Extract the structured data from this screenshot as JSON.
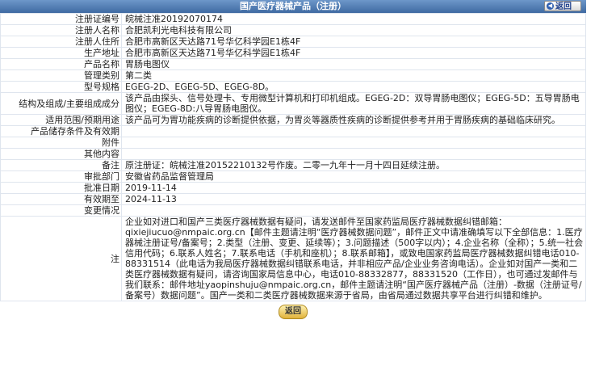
{
  "header": {
    "title": "国产医疗器械产品（注册）",
    "back_label": "返回"
  },
  "rows": [
    {
      "label": "注册证编号",
      "value": "皖械注准20192070174"
    },
    {
      "label": "注册人名称",
      "value": "合肥凯利光电科技有限公司"
    },
    {
      "label": "注册人住所",
      "value": "合肥市高新区天达路71号华亿科学园E1栋4F"
    },
    {
      "label": "生产地址",
      "value": "合肥市高新区天达路71号华亿科学园E1栋4F"
    },
    {
      "label": "产品名称",
      "value": "胃肠电图仪"
    },
    {
      "label": "管理类别",
      "value": "第二类"
    },
    {
      "label": "型号规格",
      "value": "EGEG-2D、EGEG-5D、EGEG-8D。"
    },
    {
      "label": "结构及组成/主要组成成分",
      "value": "该产品由探头、信号处理卡、专用微型计算机和打印机组成。EGEG-2D：双导胃肠电图仪；EGEG-5D：五导胃肠电图仪；EGEG-8D:八导胃肠电图仪。"
    },
    {
      "label": "适用范围/预期用途",
      "value": "该产品可为胃功能疾病的诊断提供依据，为胃炎等器质性疾病的诊断提供参考并用于胃肠疾病的基础临床研究。"
    },
    {
      "label": "产品储存条件及有效期",
      "value": ""
    },
    {
      "label": "附件",
      "value": ""
    },
    {
      "label": "其他内容",
      "value": ""
    },
    {
      "label": "备注",
      "value": "原注册证：皖械注准20152210132号作废。二零一九年十一月十四日延续注册。"
    },
    {
      "label": "审批部门",
      "value": "安徽省药品监督管理局"
    },
    {
      "label": "批准日期",
      "value": "2019-11-14"
    },
    {
      "label": "有效期至",
      "value": "2024-11-13"
    },
    {
      "label": "变更情况",
      "value": ""
    }
  ],
  "note": {
    "label": "注",
    "value": "企业如对进口和国产三类医疗器械数据有疑问，请发送邮件至国家药监局医疗器械数据纠错邮箱：qixiejiucuo@nmpaic.org.cn【邮件主题请注明“医疗器械数据问题”，邮件正文中请准确填写以下全部信息：1.医疗器械注册证号/备案号；2.类型（注册、变更、延续等）；3.问题描述（500字以内）；4.企业名称（全称）；5.统一社会信用代码；6.联系人姓名；7.联系电话（手机和座机）；8.联系邮箱】，或致电国家药监局医疗器械数据纠错电话010-88331514（此电话为我局医疗器械数据纠错联系电话，并非相应产品/企业业务咨询电话）。企业如对国产一类和二类医疗器械数据有疑问，请咨询国家局信息中心，电话010-88332877，88331520（工作日），也可通过发邮件与我们联系：邮件地址yaopinshuju@nmpaic.org.cn，邮件主题请注明“国产医疗器械产品（注册）-数据（注册证号/备案号）数据问题”。国产一类和二类医疗器械数据来源于省局，由省局通过数据共享平台进行纠错和维护。"
  },
  "footer": {
    "back_label": "返回"
  }
}
